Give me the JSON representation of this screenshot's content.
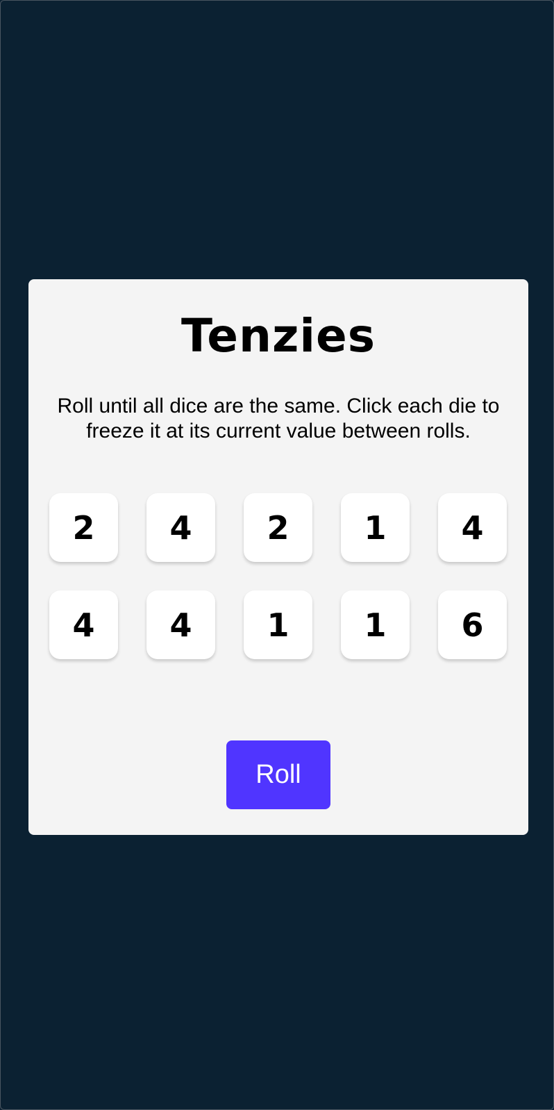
{
  "colors": {
    "page_background": "#0b2132",
    "card_background": "#f4f4f4",
    "die_background": "#ffffff",
    "button_background": "#5035ff",
    "button_text": "#ffffff"
  },
  "game": {
    "title": "Tenzies",
    "instructions": "Roll until all dice are the same. Click each die to freeze it at its current value between rolls.",
    "dice": [
      "2",
      "4",
      "2",
      "1",
      "4",
      "4",
      "4",
      "1",
      "1",
      "6"
    ],
    "roll_label": "Roll"
  }
}
